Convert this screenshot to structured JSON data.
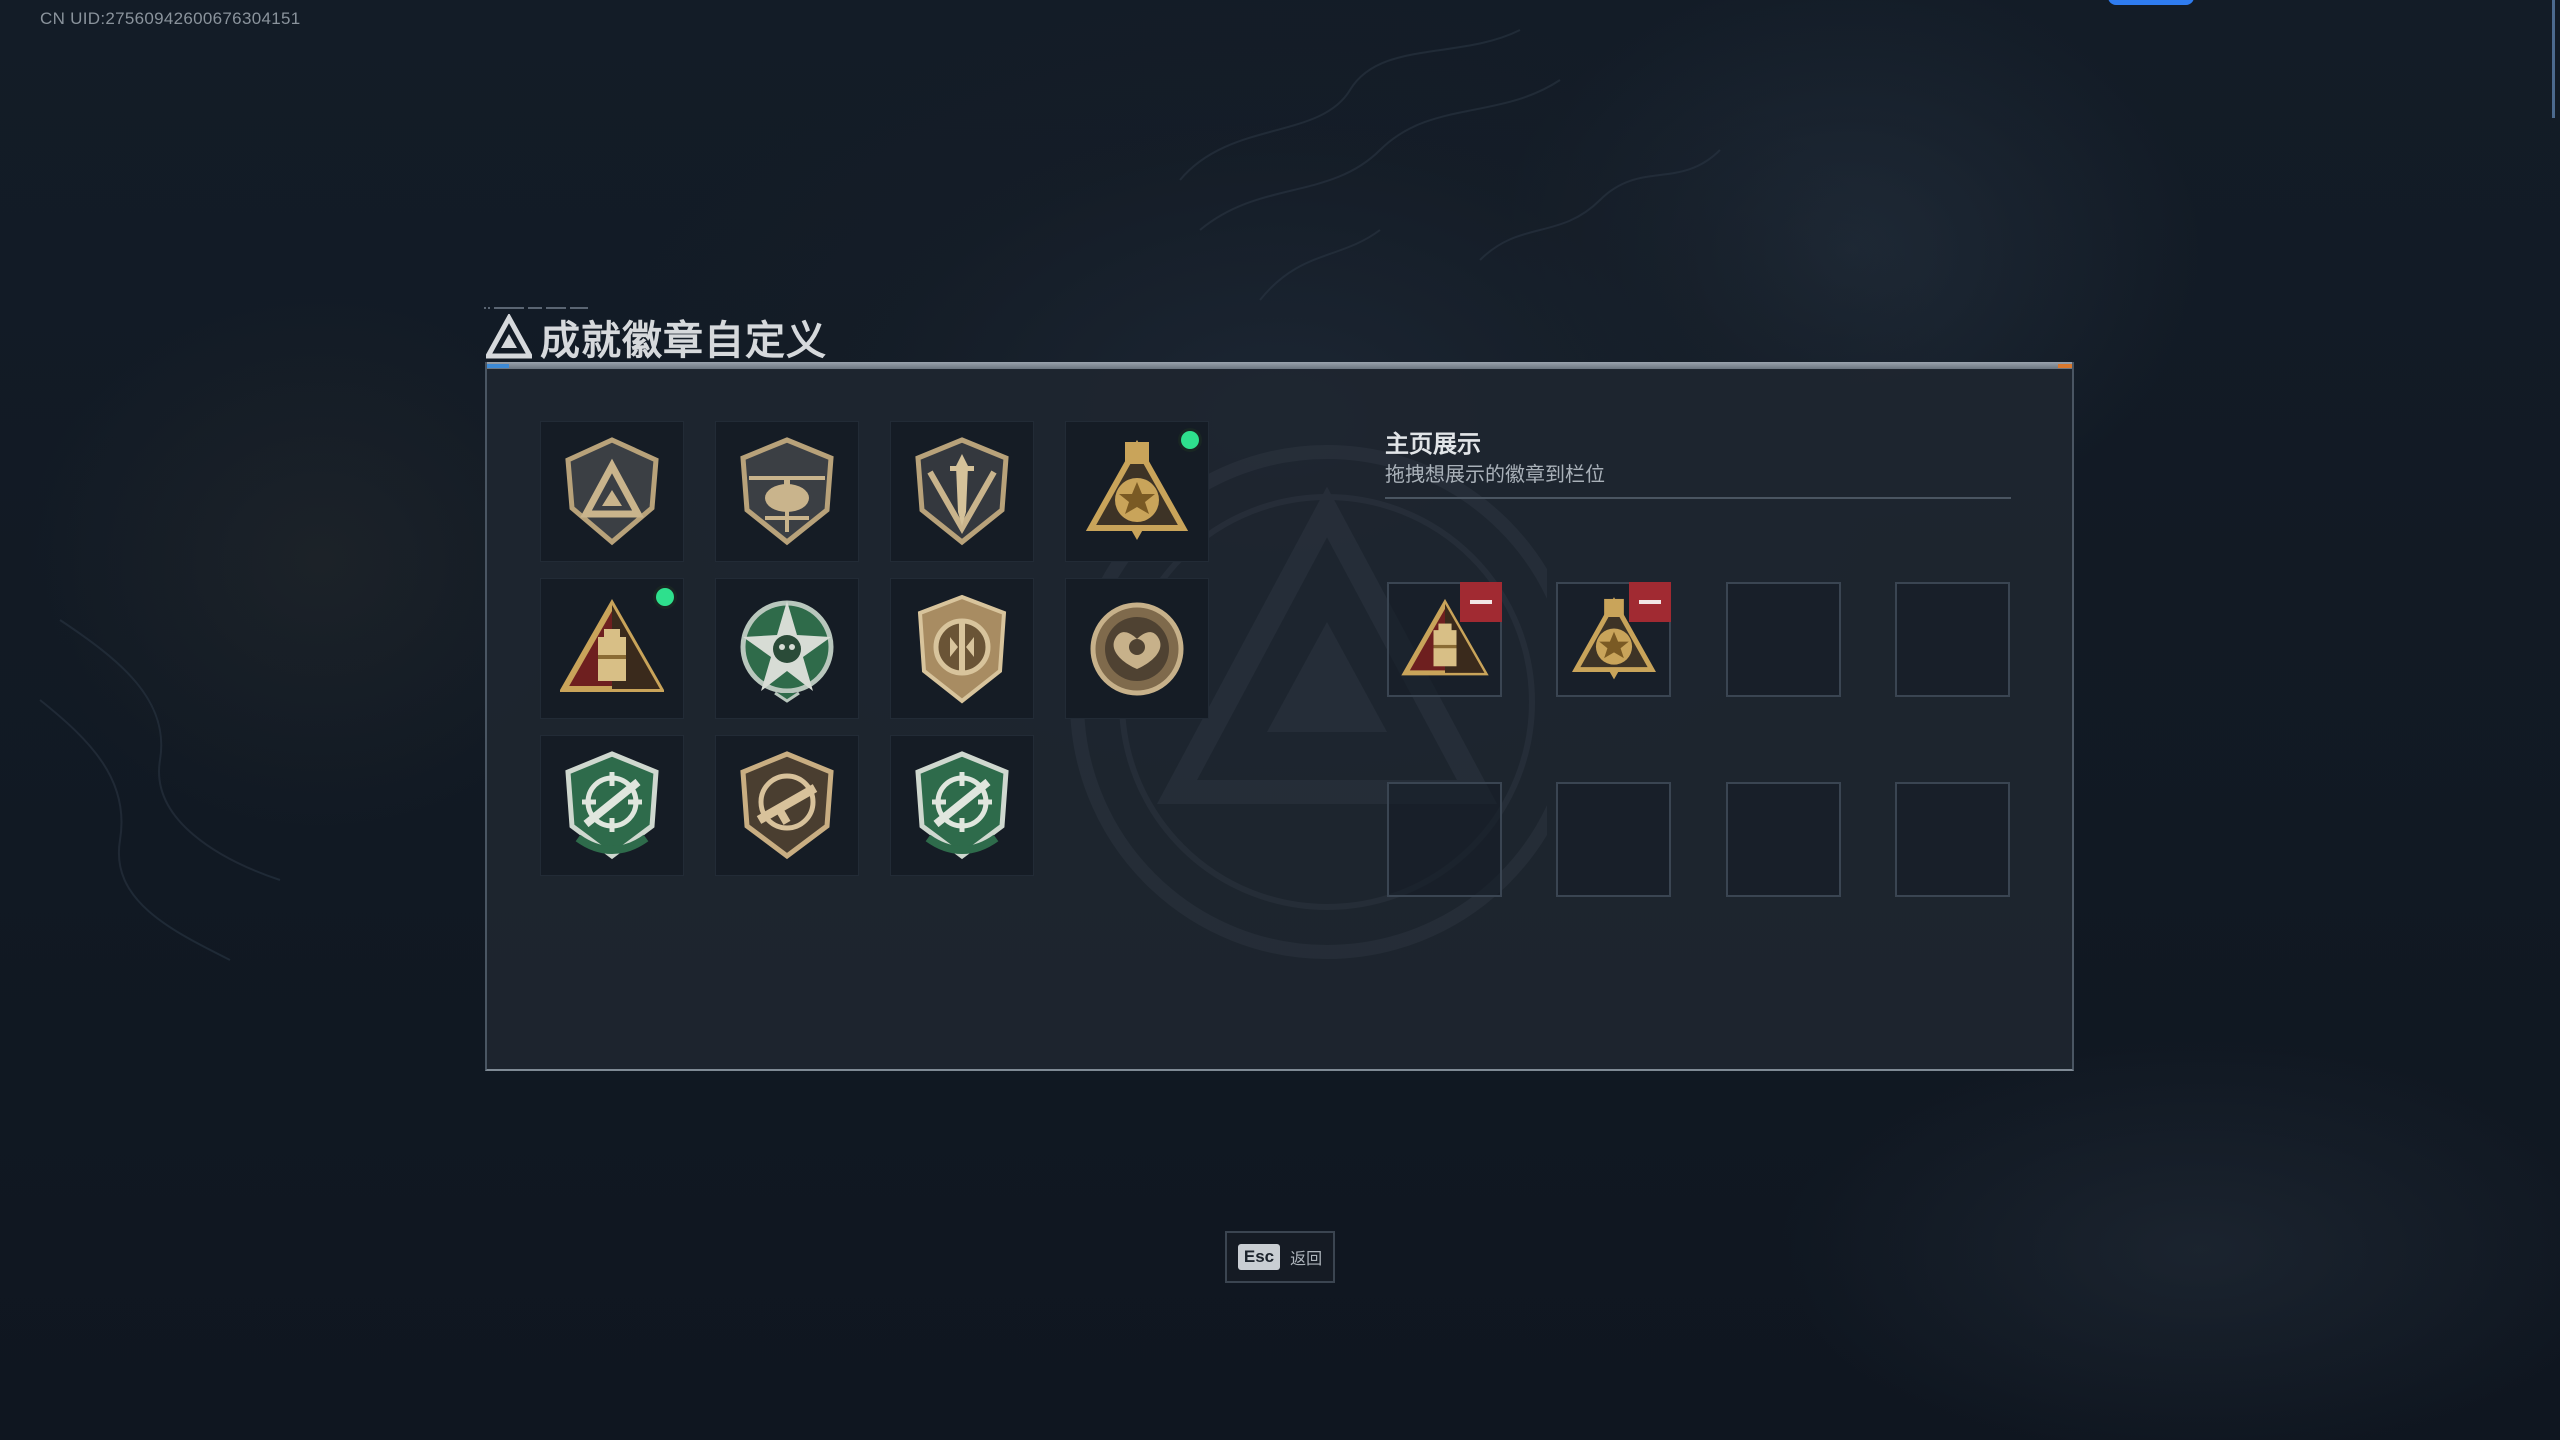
{
  "header": {
    "uid_text": "CN UID:27560942600676304151"
  },
  "dialog": {
    "title": "成就徽章自定义"
  },
  "badges": [
    {
      "name": "delta-shield-badge",
      "new": false
    },
    {
      "name": "helicopter-badge",
      "new": false
    },
    {
      "name": "dagger-shield-badge",
      "new": false
    },
    {
      "name": "gold-star-pyramid-badge",
      "new": true
    },
    {
      "name": "gold-red-pyramid-badge",
      "new": true
    },
    {
      "name": "green-skull-star-badge",
      "new": false
    },
    {
      "name": "bronze-emblem-badge",
      "new": false
    },
    {
      "name": "round-bronze-emblem-badge",
      "new": false
    },
    {
      "name": "green-crosshair-rifle-badge",
      "new": false
    },
    {
      "name": "bronze-smg-badge",
      "new": false
    },
    {
      "name": "green-crosshair-rifle-badge-2",
      "new": false
    }
  ],
  "showcase": {
    "title": "主页展示",
    "subtitle": "拖拽想展示的徽章到栏位",
    "slots": [
      "gold-red-pyramid-badge",
      "gold-star-pyramid-badge",
      "",
      "",
      "",
      "",
      "",
      ""
    ]
  },
  "footer": {
    "esc_key": "Esc",
    "back_label": "返回"
  },
  "colors": {
    "accent_new": "#2ee08d",
    "remove": "#a12a32",
    "highlight": "#2f7cf0"
  }
}
